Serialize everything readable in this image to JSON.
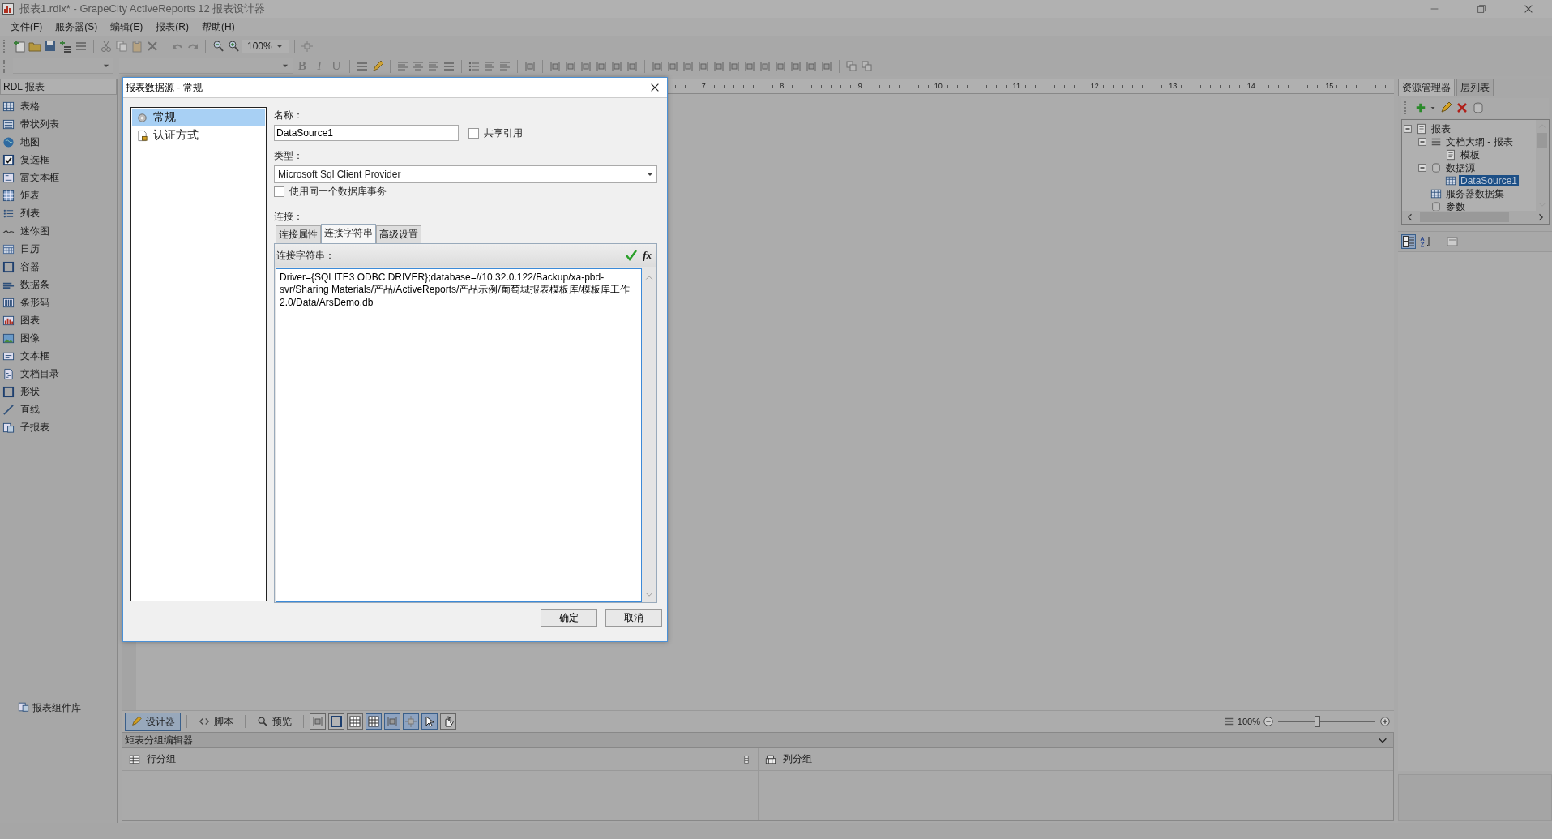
{
  "window": {
    "title": "报表1.rdlx* - GrapeCity ActiveReports 12 报表设计器"
  },
  "menu": [
    "文件(F)",
    "服务器(S)",
    "编辑(E)",
    "报表(R)",
    "帮助(H)"
  ],
  "toolbar": {
    "zoom": "100%",
    "format_buttons": [
      "B",
      "I",
      "U"
    ]
  },
  "toolbox": {
    "title": "RDL 报表",
    "items": [
      "表格",
      "带状列表",
      "地图",
      "复选框",
      "富文本框",
      "矩表",
      "列表",
      "迷你图",
      "日历",
      "容器",
      "数据条",
      "条形码",
      "图表",
      "图像",
      "文本框",
      "文档目录",
      "形状",
      "直线",
      "子报表"
    ],
    "footer": "报表组件库"
  },
  "ruler": {
    "labels": [
      "7",
      "8",
      "9",
      "10",
      "11",
      "12",
      "13",
      "14",
      "15"
    ]
  },
  "explorer": {
    "tabs": [
      {
        "label": "资源管理器",
        "selected": true
      },
      {
        "label": "层列表",
        "selected": false
      }
    ],
    "tree": [
      {
        "label": "报表",
        "expanded": true,
        "selected": false,
        "children": [
          {
            "label": "文档大纲 - 报表",
            "expanded": true,
            "selected": false,
            "children": [
              {
                "label": "模板",
                "selected": false
              }
            ]
          },
          {
            "label": "数据源",
            "expanded": true,
            "selected": false,
            "children": [
              {
                "label": "DataSource1",
                "selected": true
              }
            ]
          },
          {
            "label": "服务器数据集",
            "selected": false
          },
          {
            "label": "参数",
            "selected": false
          }
        ]
      }
    ]
  },
  "designer_tabs": [
    {
      "label": "设计器",
      "selected": true
    },
    {
      "label": "脚本",
      "selected": false
    },
    {
      "label": "预览",
      "selected": false
    }
  ],
  "zoom": {
    "reading": "100%",
    "level": 0.4
  },
  "group_editor": {
    "title": "矩表分组编辑器",
    "row_groups": "行分组",
    "column_groups": "列分组"
  },
  "dialog": {
    "title": "报表数据源 - 常规",
    "nav": [
      {
        "label": "常规",
        "selected": true
      },
      {
        "label": "认证方式",
        "selected": false
      }
    ],
    "name_label": "名称：",
    "name_value": "DataSource1",
    "shared_reference": {
      "label": "共享引用",
      "checked": false
    },
    "type_label": "类型：",
    "type_value": "Microsoft Sql Client Provider",
    "same_transaction": {
      "label": "使用同一个数据库事务",
      "checked": false
    },
    "connection_label": "连接：",
    "tabs": [
      {
        "label": "连接属性",
        "selected": false
      },
      {
        "label": "连接字符串",
        "selected": true
      },
      {
        "label": "高级设置",
        "selected": false
      }
    ],
    "connection_string_label": "连接字符串：",
    "expression_button": "fx",
    "connection_string": "Driver={SQLITE3 ODBC DRIVER};database=//10.32.0.122/Backup/xa-pbd-svr/Sharing Materials/产品/ActiveReports/产品示例/葡萄城报表模板库/模板库工作2.0/Data/ArsDemo.db",
    "buttons": [
      "确定",
      "取消"
    ]
  }
}
